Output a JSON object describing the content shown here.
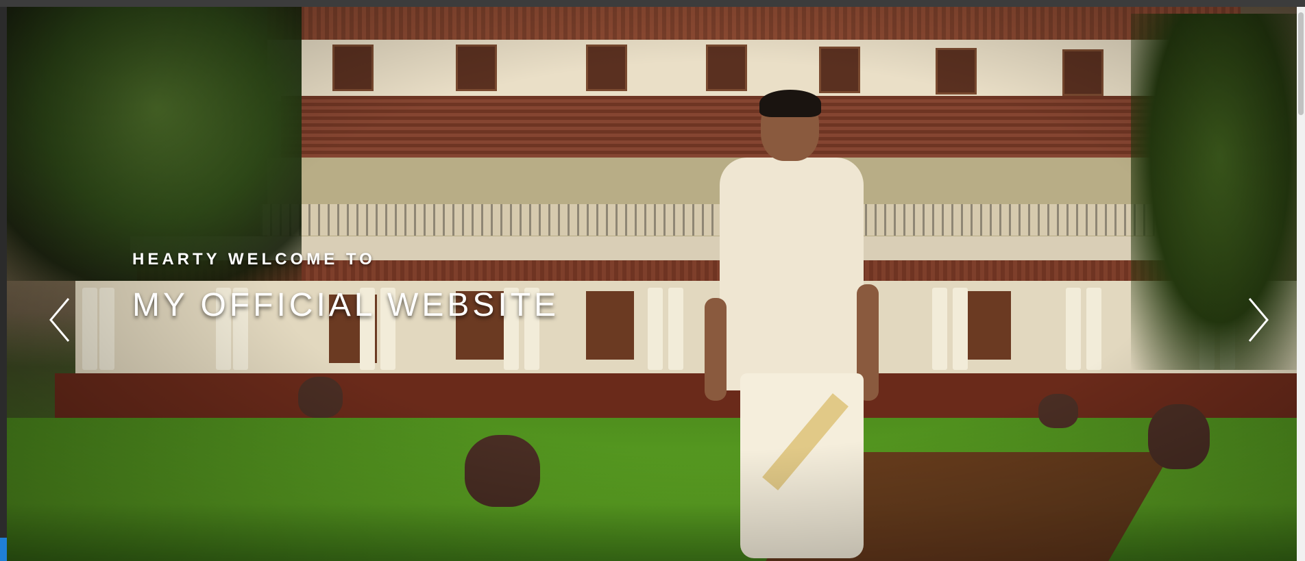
{
  "hero": {
    "welcome": "HEARTY WELCOME TO",
    "title": "MY OFFICIAL WEBSITE",
    "prev_icon": "chevron-left-icon",
    "next_icon": "chevron-right-icon"
  },
  "colors": {
    "text": "#ffffff",
    "accent": "#1f7fd6"
  }
}
